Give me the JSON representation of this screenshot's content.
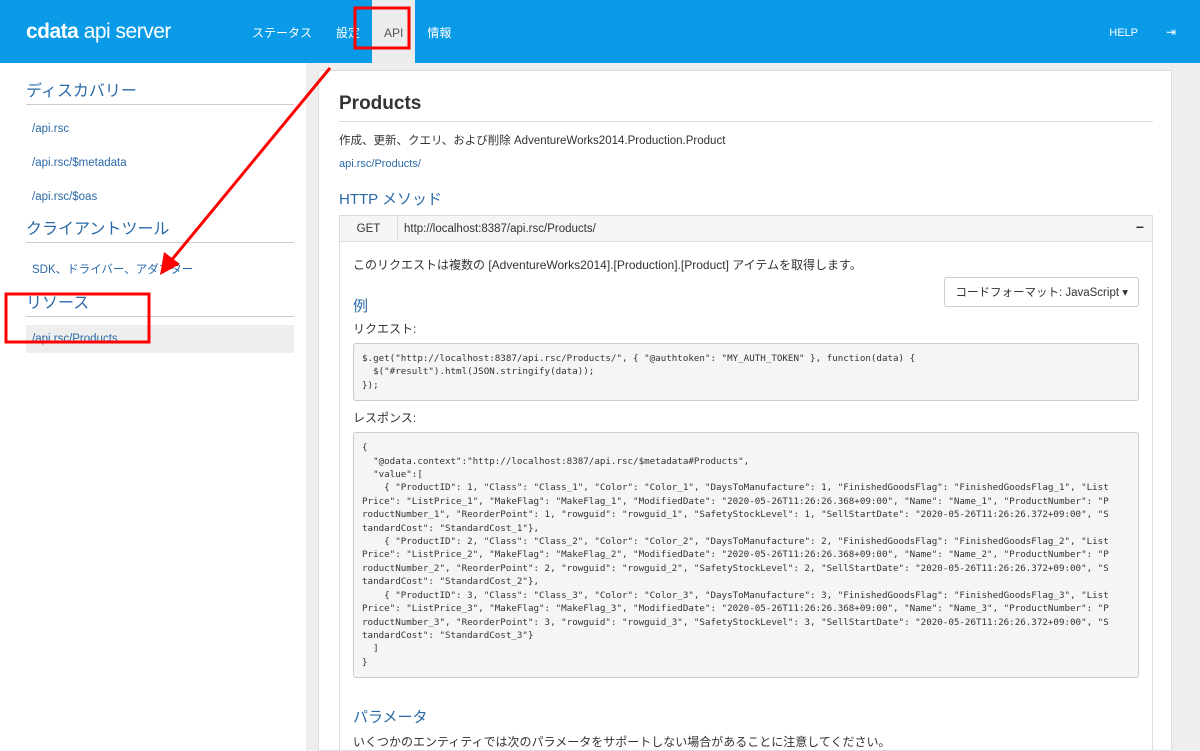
{
  "header": {
    "logo_brand": "cdata",
    "logo_product": "api server",
    "nav": [
      "ステータス",
      "設定",
      "API",
      "情報"
    ],
    "help": "HELP",
    "logout_icon": "sign-out-icon"
  },
  "sidebar": {
    "discovery_title": "ディスカバリー",
    "discovery": [
      "/api.rsc",
      "/api.rsc/$metadata",
      "/api.rsc/$oas"
    ],
    "tools_title": "クライアントツール",
    "tools": [
      "SDK、ドライバー、アダプター"
    ],
    "resources_title": "リソース",
    "resources": [
      "/api.rsc/Products"
    ]
  },
  "main": {
    "title": "Products",
    "description": "作成、更新、クエリ、および削除 AdventureWorks2014.Production.Product",
    "path_link": "api.rsc/Products/",
    "http_title": "HTTP メソッド",
    "method": "GET",
    "endpoint": "http://localhost:8387/api.rsc/Products/",
    "collapse": "−",
    "method_desc": "このリクエストは複数の [AdventureWorks2014].[Production].[Product] アイテムを取得します。",
    "code_format": "コードフォーマット: JavaScript ▾",
    "example_title": "例",
    "request_label": "リクエスト:",
    "request_lines": [
      "$.get(\"http://localhost:8387/api.rsc/Products/\", { \"@authtoken\": \"MY_AUTH_TOKEN\" }, function(data) {",
      "  $(\"#result\").html(JSON.stringify(data));",
      "});"
    ],
    "response_label": "レスポンス:",
    "response_lines": [
      "{",
      "  \"@odata.context\":\"http://localhost:8387/api.rsc/$metadata#Products\",",
      "  \"value\":[",
      "    { \"ProductID\": 1, \"Class\": \"Class_1\", \"Color\": \"Color_1\", \"DaysToManufacture\": 1, \"FinishedGoodsFlag\": \"FinishedGoodsFlag_1\", \"List",
      "Price\": \"ListPrice_1\", \"MakeFlag\": \"MakeFlag_1\", \"ModifiedDate\": \"2020-05-26T11:26:26.368+09:00\", \"Name\": \"Name_1\", \"ProductNumber\": \"P",
      "roductNumber_1\", \"ReorderPoint\": 1, \"rowguid\": \"rowguid_1\", \"SafetyStockLevel\": 1, \"SellStartDate\": \"2020-05-26T11:26:26.372+09:00\", \"S",
      "tandardCost\": \"StandardCost_1\"},",
      "    { \"ProductID\": 2, \"Class\": \"Class_2\", \"Color\": \"Color_2\", \"DaysToManufacture\": 2, \"FinishedGoodsFlag\": \"FinishedGoodsFlag_2\", \"List",
      "Price\": \"ListPrice_2\", \"MakeFlag\": \"MakeFlag_2\", \"ModifiedDate\": \"2020-05-26T11:26:26.368+09:00\", \"Name\": \"Name_2\", \"ProductNumber\": \"P",
      "roductNumber_2\", \"ReorderPoint\": 2, \"rowguid\": \"rowguid_2\", \"SafetyStockLevel\": 2, \"SellStartDate\": \"2020-05-26T11:26:26.372+09:00\", \"S",
      "tandardCost\": \"StandardCost_2\"},",
      "    { \"ProductID\": 3, \"Class\": \"Class_3\", \"Color\": \"Color_3\", \"DaysToManufacture\": 3, \"FinishedGoodsFlag\": \"FinishedGoodsFlag_3\", \"List",
      "Price\": \"ListPrice_3\", \"MakeFlag\": \"MakeFlag_3\", \"ModifiedDate\": \"2020-05-26T11:26:26.368+09:00\", \"Name\": \"Name_3\", \"ProductNumber\": \"P",
      "roductNumber_3\", \"ReorderPoint\": 3, \"rowguid\": \"rowguid_3\", \"SafetyStockLevel\": 3, \"SellStartDate\": \"2020-05-26T11:26:26.372+09:00\", \"S",
      "tandardCost\": \"StandardCost_3\"}",
      "  ]",
      "}"
    ],
    "params_title": "パラメータ",
    "params_desc": "いくつかのエンティティでは次のパラメータをサポートしない場合があることに注意してください。"
  },
  "colors": {
    "header": "#0a9be8",
    "link": "#2a6aa8",
    "annotation": "#ff0000"
  }
}
